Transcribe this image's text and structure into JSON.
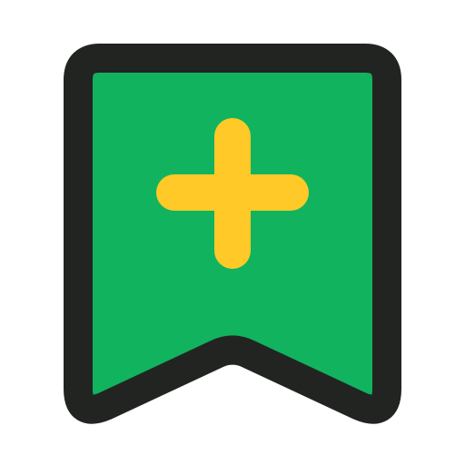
{
  "icon": {
    "semantic": "bookmark-add-icon",
    "colors": {
      "outline": "#222422",
      "fill": "#11B35E",
      "plus": "#FFC928",
      "background": "#FFFFFF"
    }
  }
}
